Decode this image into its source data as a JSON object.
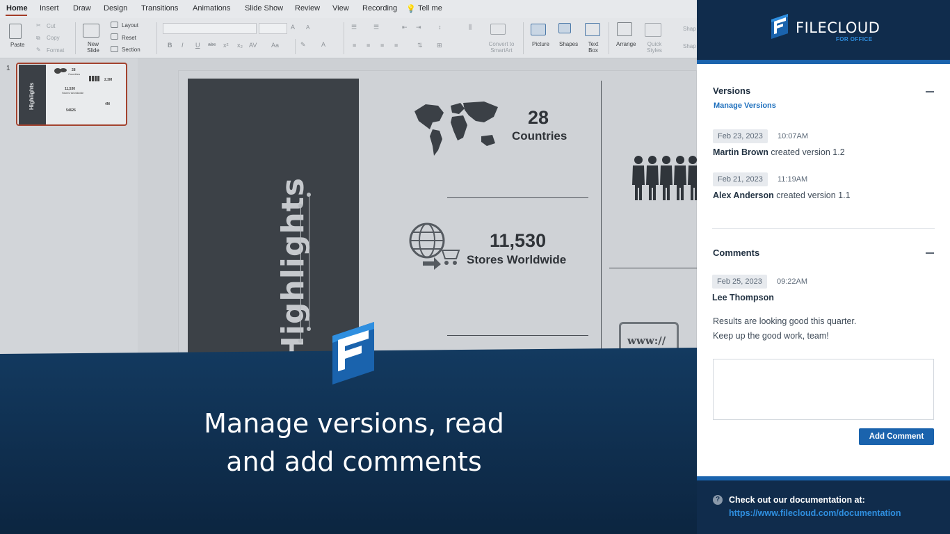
{
  "ppt": {
    "tabs": [
      "Home",
      "Insert",
      "Draw",
      "Design",
      "Transitions",
      "Animations",
      "Slide Show",
      "Review",
      "View",
      "Recording"
    ],
    "tell_me": "Tell me",
    "clipboard": {
      "paste": "Paste",
      "cut": "Cut",
      "copy": "Copy",
      "format": "Format"
    },
    "slides": {
      "new_slide": "New Slide",
      "layout": "Layout",
      "reset": "Reset",
      "section": "Section"
    },
    "insert": {
      "convert": "Convert to SmartArt",
      "picture": "Picture",
      "shapes": "Shapes",
      "text_box": "Text Box",
      "arrange": "Arrange",
      "quick_styles": "Quick Styles",
      "shape": "Shap"
    },
    "format_glyphs": {
      "bold": "B",
      "italic": "I",
      "underline": "U",
      "strike": "abc",
      "superscript": "x²",
      "subscript": "x₂",
      "spacing": "AV",
      "case": "Aa",
      "font_grow": "A",
      "font_shrink": "A"
    },
    "slide_number": "1",
    "thumbnail": {
      "title": "Highlights",
      "stat1": "28",
      "stat1_label": "Countries",
      "stat2": "2.3M",
      "stat3": "11,530",
      "stat3_label": "Stores Worldwide",
      "stat4": "4M",
      "stat5": "54626"
    },
    "slide": {
      "title": "Highlights",
      "stat1_value": "28",
      "stat1_label": "Countries",
      "stat2_value": "11,530",
      "stat2_label": "Stores Worldwide",
      "www": "www://"
    }
  },
  "promo": {
    "line1": "Manage versions, read",
    "line2": "and add comments"
  },
  "panel": {
    "brand": "FILECLOUD",
    "brand_sub": "FOR OFFICE",
    "versions": {
      "title": "Versions",
      "manage_link": "Manage Versions",
      "items": [
        {
          "date": "Feb 23, 2023",
          "time": "10:07AM",
          "user": "Martin Brown",
          "action": "created version 1.2"
        },
        {
          "date": "Feb 21, 2023",
          "time": "11:19AM",
          "user": "Alex Anderson",
          "action": "created version 1.1"
        }
      ]
    },
    "comments": {
      "title": "Comments",
      "items": [
        {
          "date": "Feb 25, 2023",
          "time": "09:22AM",
          "user": "Lee Thompson",
          "line1": "Results are looking good this quarter.",
          "line2": "Keep up the good work, team!"
        }
      ],
      "input_value": "",
      "add_button": "Add Comment"
    },
    "footer": {
      "text": "Check out our documentation at:",
      "link": "https://www.filecloud.com/documentation",
      "help_icon": "?"
    }
  },
  "colors": {
    "brand_blue": "#1a63ad",
    "navy": "#102c4c",
    "link": "#1d6fbd",
    "accent_red": "#a3422e"
  }
}
